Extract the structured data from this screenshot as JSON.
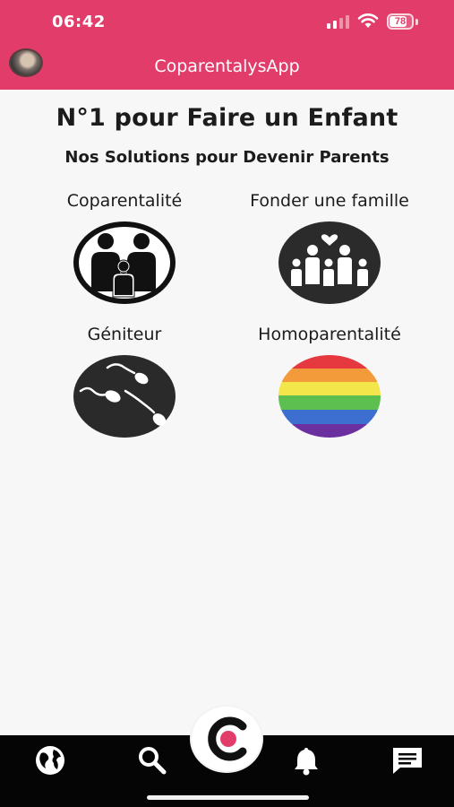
{
  "status_bar": {
    "time": "06:42",
    "battery": "78",
    "battery_level": 0.78
  },
  "app_bar": {
    "title": "CoparentalysApp",
    "accent_color": "#e23d6a"
  },
  "main": {
    "title": "N°1 pour Faire un Enfant",
    "subtitle": "Nos Solutions pour Devenir Parents",
    "tiles": [
      {
        "label": "Coparentalité",
        "icon": "family-icon"
      },
      {
        "label": "Fonder une famille",
        "icon": "family-heart-icon"
      },
      {
        "label": "Géniteur",
        "icon": "sperm-icon"
      },
      {
        "label": "Homoparentalité",
        "icon": "rainbow-flag-icon"
      }
    ]
  },
  "bottom_nav": {
    "items": [
      {
        "icon": "globe-icon"
      },
      {
        "icon": "search-icon"
      },
      {
        "icon": "app-logo-icon"
      },
      {
        "icon": "bell-icon"
      },
      {
        "icon": "chat-icon"
      }
    ],
    "background": "#050505"
  }
}
